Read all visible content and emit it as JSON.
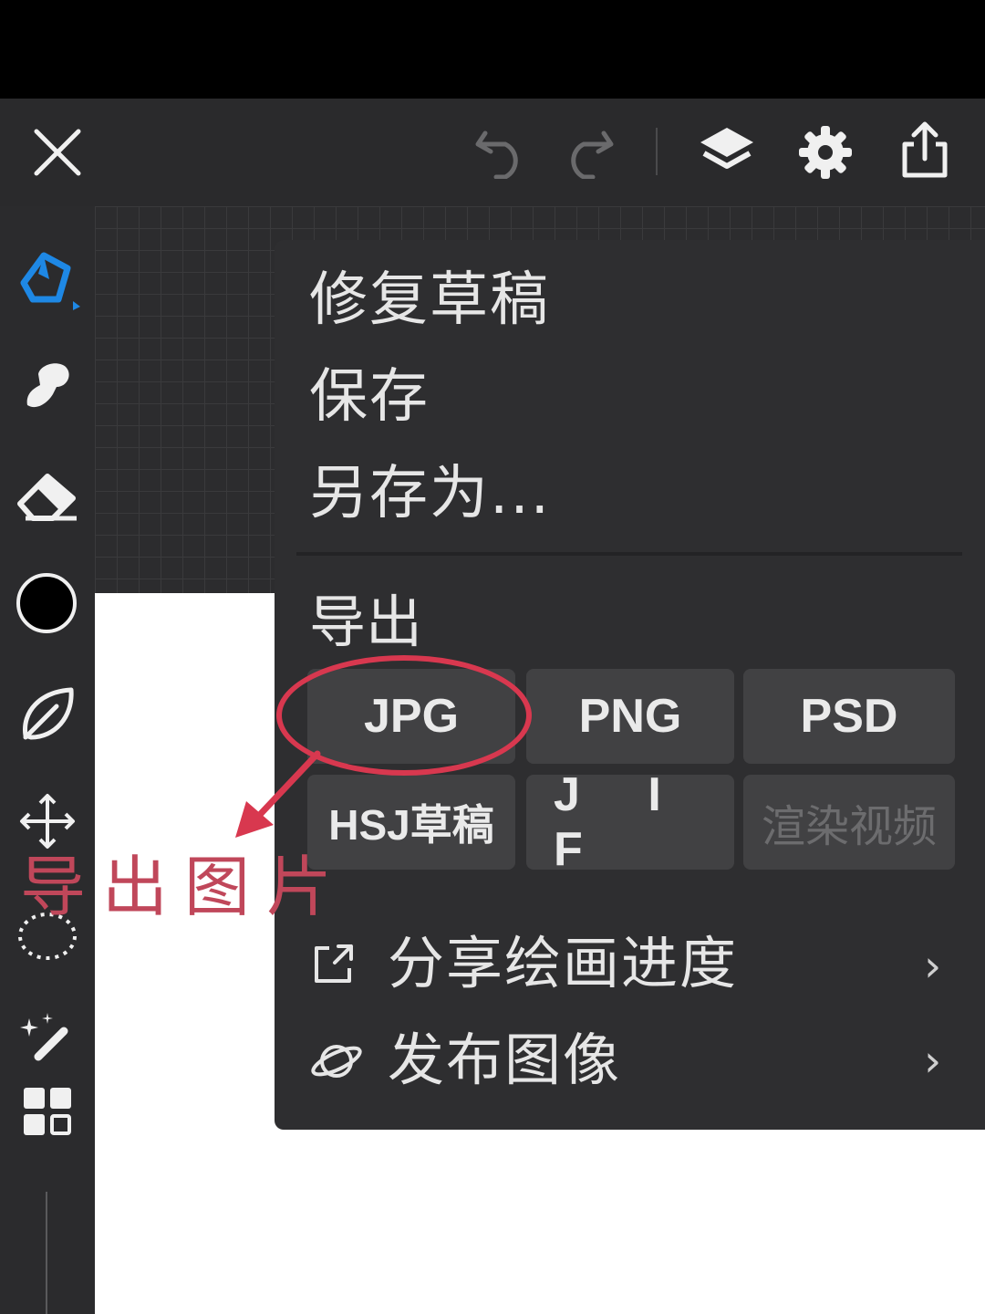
{
  "toolbar": {
    "icons": [
      "close-icon",
      "undo-icon",
      "redo-icon",
      "layers-icon",
      "gear-icon",
      "share-icon"
    ]
  },
  "left_rail": {
    "tools": [
      "brush-icon",
      "smudge-icon",
      "eraser-icon",
      "color-swatch",
      "leaf-icon",
      "transform-icon",
      "lasso-icon",
      "magic-wand-icon",
      "grid-icon"
    ],
    "active_color": "#000000",
    "accent_color": "#1e88e5"
  },
  "menu": {
    "items": [
      "修复草稿",
      "保存",
      "另存为..."
    ],
    "export_label": "导出",
    "formats_row1": [
      "JPG",
      "PNG",
      "PSD"
    ],
    "formats_row2": [
      "HSJ草稿",
      "J I F",
      "渲染视频"
    ],
    "share_progress": "分享绘画进度",
    "publish_image": "发布图像"
  },
  "annotation": {
    "text": "导出图片",
    "color": "#d8384f"
  }
}
